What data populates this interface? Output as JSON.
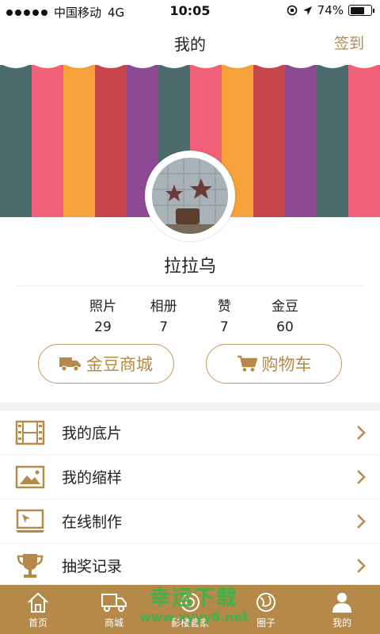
{
  "status_bar": {
    "carrier": "中国移动",
    "network": "4G",
    "time": "10:05",
    "battery": "74%",
    "battery_level": 0.74
  },
  "nav": {
    "title": "我的",
    "signin_label": "签到"
  },
  "banner": {
    "stripe_colors": [
      "#4d6b6c",
      "#f2607a",
      "#f6a13a",
      "#c8474b",
      "#8e4a93",
      "#4d6b6c",
      "#f2607a",
      "#f6a13a",
      "#c8474b",
      "#8e4a93",
      "#4d6b6c",
      "#f2607a"
    ]
  },
  "profile": {
    "username": "拉拉乌"
  },
  "stats": [
    {
      "label": "照片",
      "value": "29"
    },
    {
      "label": "相册",
      "value": "7"
    },
    {
      "label": "赞",
      "value": "7"
    },
    {
      "label": "金豆",
      "value": "60"
    }
  ],
  "actions": {
    "gold_mall_label": "金豆商城",
    "cart_label": "购物车",
    "gold_mall_icon": "truck-icon",
    "cart_icon": "cart-icon"
  },
  "menu": [
    {
      "label": "我的底片",
      "icon": "film-icon"
    },
    {
      "label": "我的缩样",
      "icon": "picture-icon"
    },
    {
      "label": "在线制作",
      "icon": "laptop-icon"
    },
    {
      "label": "抽奖记录",
      "icon": "trophy-icon"
    }
  ],
  "tabbar": [
    {
      "label": "首页",
      "icon": "home-icon"
    },
    {
      "label": "商城",
      "icon": "truck-icon"
    },
    {
      "label": "影楼管家",
      "icon": "camera-icon"
    },
    {
      "label": "圈子",
      "icon": "globe-icon"
    },
    {
      "label": "我的",
      "icon": "user-icon"
    }
  ],
  "watermark": {
    "text": "幸运下载",
    "url": "www.xyyy8.net"
  },
  "colors": {
    "accent": "#b5894a",
    "tabbar": "#b5894a"
  }
}
